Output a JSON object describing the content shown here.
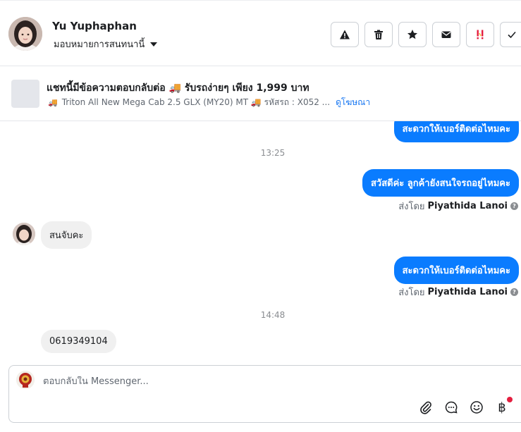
{
  "header": {
    "contact_name": "Yu Yuphaphan",
    "assign_label": "มอบหมายการสนทนานี้",
    "actions": [
      {
        "name": "report-button",
        "icon": "warning-icon"
      },
      {
        "name": "delete-button",
        "icon": "trash-icon"
      },
      {
        "name": "star-button",
        "icon": "star-icon"
      },
      {
        "name": "mark-unread-button",
        "icon": "envelope-icon"
      },
      {
        "name": "spam-button",
        "icon": "spam-icon"
      },
      {
        "name": "mark-done-button",
        "icon": "check-icon"
      }
    ]
  },
  "banner": {
    "title": "แชทนี้มีข้อความตอบกลับต่อ 🚚 รับรถง่ายๆ เพียง 1,999 บาท",
    "subtitle": "Triton All New Mega Cab 2.5 GLX (MY20) MT 🚚 รหัสรถ : X052 ...",
    "link_label": "ดูโฆษณา"
  },
  "thread": {
    "partial_top_message": "สะดวกให้เบอร์ติดต่อไหมคะ",
    "time_1": "13:25",
    "msg_out_1": "สวัสดีค่ะ ลูกค้ายังสนใจรถอยู่ไหมคะ",
    "sent_by_prefix": "ส่งโดย",
    "sent_by_name": "Piyathida Lanoi",
    "msg_in_1": "สนจับคะ",
    "msg_out_2": "สะดวกให้เบอร์ติดต่อไหมคะ",
    "time_2": "14:48",
    "msg_in_2": "0619349104"
  },
  "composer": {
    "placeholder": "ตอบกลับใน Messenger...",
    "tools": [
      "paperclip-icon",
      "chat-bubble-icon",
      "smiley-icon",
      "baht-icon"
    ]
  },
  "colors": {
    "brand_blue": "#0a7cff",
    "link_blue": "#1877f2",
    "incoming_bubble": "#f0f0f0",
    "notification_red": "#e41e3f"
  }
}
